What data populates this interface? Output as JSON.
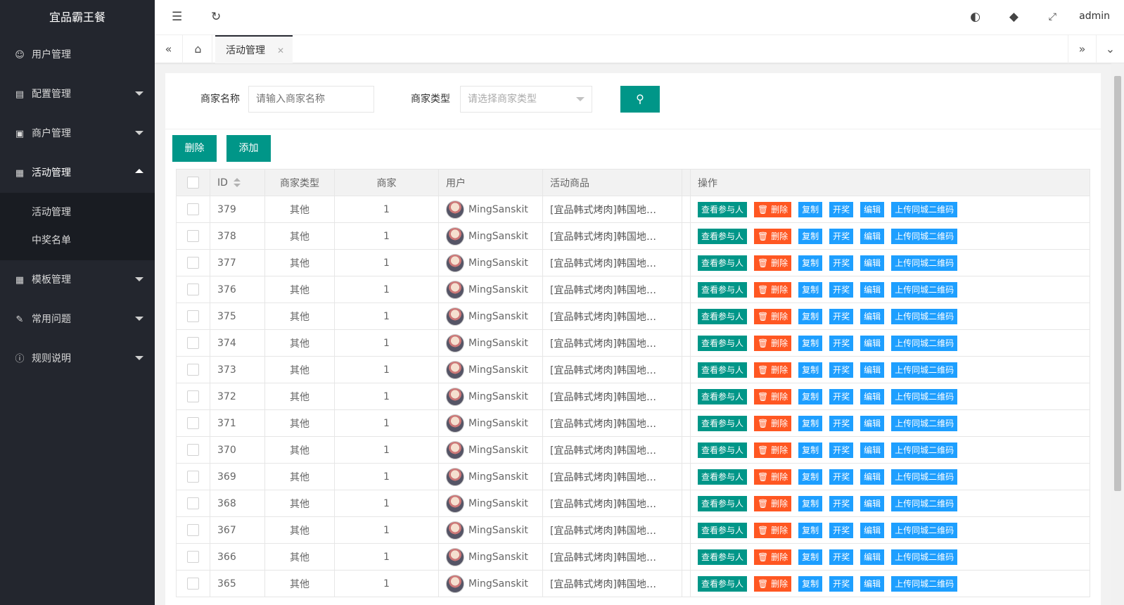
{
  "app": {
    "title": "宜品霸王餐"
  },
  "sidebar": {
    "items": [
      {
        "label": "用户管理",
        "icon": "user-icon",
        "expanded": false
      },
      {
        "label": "配置管理",
        "icon": "config-icon",
        "expanded": false
      },
      {
        "label": "商户管理",
        "icon": "shop-icon",
        "expanded": false
      },
      {
        "label": "活动管理",
        "icon": "gift-icon",
        "expanded": true
      },
      {
        "label": "模板管理",
        "icon": "template-icon",
        "expanded": false
      },
      {
        "label": "常用问题",
        "icon": "question-edit-icon",
        "expanded": false
      },
      {
        "label": "规则说明",
        "icon": "help-circle-icon",
        "expanded": false
      }
    ],
    "sub_items": [
      "活动管理",
      "中奖名单"
    ]
  },
  "header": {
    "user": "admin"
  },
  "tabs": {
    "active": "活动管理"
  },
  "search": {
    "merchant_name_label": "商家名称",
    "merchant_name_placeholder": "请输入商家名称",
    "merchant_type_label": "商家类型",
    "merchant_type_placeholder": "请选择商家类型"
  },
  "toolbar": {
    "delete_label": "删除",
    "add_label": "添加"
  },
  "table": {
    "headers": [
      "ID",
      "商家类型",
      "商家",
      "用户",
      "活动商品",
      "操作"
    ],
    "actions": [
      "查看参与人",
      "删除",
      "复制",
      "开奖",
      "编辑",
      "上传同城二维码"
    ],
    "rows": [
      {
        "id": "379",
        "type": "其他",
        "merchant": "1",
        "user": "MingSanskit",
        "goods": "[宜品韩式烤肉]韩国地域..."
      },
      {
        "id": "378",
        "type": "其他",
        "merchant": "1",
        "user": "MingSanskit",
        "goods": "[宜品韩式烤肉]韩国地域..."
      },
      {
        "id": "377",
        "type": "其他",
        "merchant": "1",
        "user": "MingSanskit",
        "goods": "[宜品韩式烤肉]韩国地域..."
      },
      {
        "id": "376",
        "type": "其他",
        "merchant": "1",
        "user": "MingSanskit",
        "goods": "[宜品韩式烤肉]韩国地域..."
      },
      {
        "id": "375",
        "type": "其他",
        "merchant": "1",
        "user": "MingSanskit",
        "goods": "[宜品韩式烤肉]韩国地域..."
      },
      {
        "id": "374",
        "type": "其他",
        "merchant": "1",
        "user": "MingSanskit",
        "goods": "[宜品韩式烤肉]韩国地域..."
      },
      {
        "id": "373",
        "type": "其他",
        "merchant": "1",
        "user": "MingSanskit",
        "goods": "[宜品韩式烤肉]韩国地域..."
      },
      {
        "id": "372",
        "type": "其他",
        "merchant": "1",
        "user": "MingSanskit",
        "goods": "[宜品韩式烤肉]韩国地域..."
      },
      {
        "id": "371",
        "type": "其他",
        "merchant": "1",
        "user": "MingSanskit",
        "goods": "[宜品韩式烤肉]韩国地域..."
      },
      {
        "id": "370",
        "type": "其他",
        "merchant": "1",
        "user": "MingSanskit",
        "goods": "[宜品韩式烤肉]韩国地域..."
      },
      {
        "id": "369",
        "type": "其他",
        "merchant": "1",
        "user": "MingSanskit",
        "goods": "[宜品韩式烤肉]韩国地域..."
      },
      {
        "id": "368",
        "type": "其他",
        "merchant": "1",
        "user": "MingSanskit",
        "goods": "[宜品韩式烤肉]韩国地域..."
      },
      {
        "id": "367",
        "type": "其他",
        "merchant": "1",
        "user": "MingSanskit",
        "goods": "[宜品韩式烤肉]韩国地域..."
      },
      {
        "id": "366",
        "type": "其他",
        "merchant": "1",
        "user": "MingSanskit",
        "goods": "[宜品韩式烤肉]韩国地域..."
      },
      {
        "id": "365",
        "type": "其他",
        "merchant": "1",
        "user": "MingSanskit",
        "goods": "[宜品韩式烤肉]韩国地域..."
      }
    ]
  },
  "colors": {
    "sidebar_bg": "#23262e",
    "primary": "#009688",
    "danger": "#ff5722",
    "info": "#1e9fff"
  }
}
